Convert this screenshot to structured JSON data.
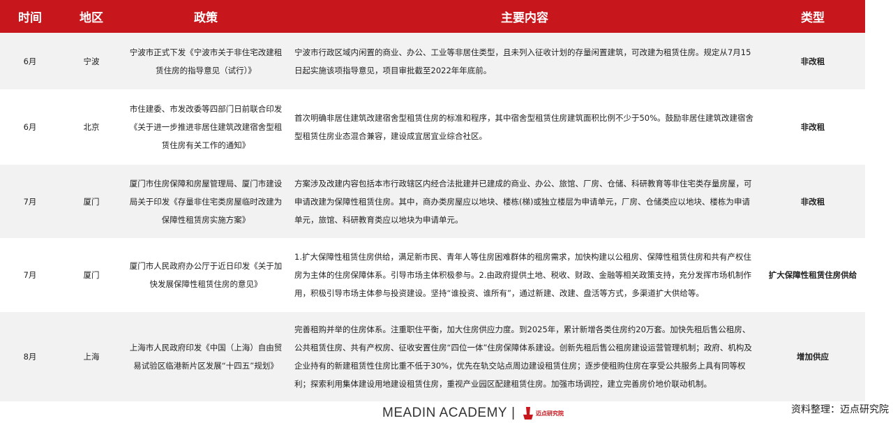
{
  "header": {
    "col_time": "时间",
    "col_region": "地区",
    "col_policy": "政策",
    "col_content": "主要内容",
    "col_type": "类型"
  },
  "rows": [
    {
      "time": "6月",
      "region": "宁波",
      "policy": "宁波市正式下发《宁波市关于非住宅改建租赁住房的指导意见（试行）》",
      "content": "宁波市行政区域内闲置的商业、办公、工业等非居住类型，且未列入征收计划的存量闲置建筑，可改建为租赁住房。规定从7月15日起实施该项指导意见，项目审批截至2022年年底前。",
      "type": "非改租"
    },
    {
      "time": "6月",
      "region": "北京",
      "policy": "市住建委、市发改委等四部门日前联合印发《关于进一步推进非居住建筑改建宿舍型租赁住房有关工作的通知》",
      "content": "首次明确非居住建筑改建宿舍型租赁住房的标准和程序，其中宿舍型租赁住房建筑面积比例不少于50%。鼓励非居住建筑改建宿舍型租赁住房业态混合兼容，建设成宜居宜业综合社区。",
      "type": "非改租"
    },
    {
      "time": "7月",
      "region": "厦门",
      "policy": "厦门市住房保障和房屋管理局、厦门市建设局关于印发《存量非住宅类房屋临时改建为保障性租赁房实施方案》",
      "content": "方案涉及改建内容包括本市行政辖区内经合法批建并已建成的商业、办公、旅馆、厂房、仓储、科研教育等非住宅类存量房屋，可申请改建为保障性租赁住房。其中，商办类房屋应以地块、楼栋(梯)或独立楼层为申请单元，厂房、仓储类应以地块、楼栋为申请单元，旅馆、科研教育类应以地块为申请单元。",
      "type": "非改租"
    },
    {
      "time": "7月",
      "region": "厦门",
      "policy": "厦门市人民政府办公厅于近日印发《关于加快发展保障性租赁住房的意见》",
      "content": "1.扩大保障性租赁住房供给，满足新市民、青年人等住房困难群体的租房需求，加快构建以公租房、保障性租赁住房和共有产权住房为主体的住房保障体系。引导市场主体积极参与。2.由政府提供土地、税收、财政、金融等相关政策支持，充分发挥市场机制作用，积极引导市场主体参与投资建设。坚持“谁投资、谁所有”，通过新建、改建、盘活等方式，多渠道扩大供给等。",
      "type": "扩大保障性租赁住房供给"
    },
    {
      "time": "8月",
      "region": "上海",
      "policy": "上海市人民政府印发《中国（上海）自由贸易试验区临港新片区发展“十四五”规划》",
      "content": "完善租购并举的住房体系。注重职住平衡，加大住房供应力度。到2025年，累计新增各类住房约20万套。加快先租后售公租房、公共租赁住房、共有产权房、征收安置住房“四位一体”住房保障体系建设。创新先租后售公租房建设运营管理机制；政府、机构及企业持有的新建租赁性住房比重不低于30%，优先在轨交站点周边建设租赁住房；逐步使租购住房在享受公共服务上具有同等权利；探索利用集体建设用地建设租赁住房，重视产业园区配建租赁住房。加强市场调控，建立完善房价地价联动机制。",
      "type": "增加供应"
    }
  ],
  "footer": {
    "brand": "MEADIN ACADEMY",
    "separator": "|",
    "logo_label": "迈点研究院",
    "source": "资料整理：迈点研究院"
  },
  "colors": {
    "header_bg": "#c8161d",
    "row_shaded": "#f2f2f2",
    "logo_red": "#c8161d"
  }
}
